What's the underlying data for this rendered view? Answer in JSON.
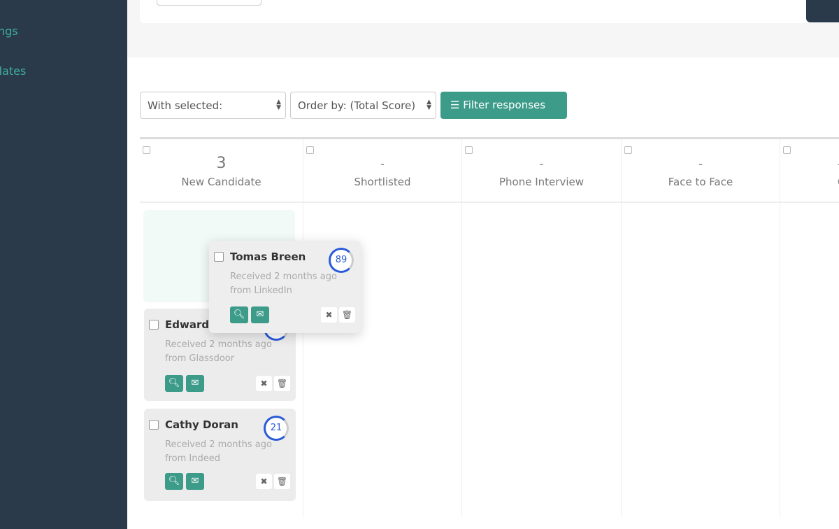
{
  "sidebar": {
    "items": [
      {
        "label": "Settings"
      },
      {
        "label": "Templates"
      }
    ]
  },
  "toolbar": {
    "with_selected": "With selected:",
    "order_by": "Order by: (Total Score)",
    "filter_label": "Filter responses"
  },
  "columns": [
    {
      "count": "3",
      "name": "New Candidate"
    },
    {
      "count": "-",
      "name": "Shortlisted"
    },
    {
      "count": "-",
      "name": "Phone Interview"
    },
    {
      "count": "-",
      "name": "Face to Face"
    },
    {
      "count": "-",
      "name": "Offer"
    }
  ],
  "cards": [
    {
      "name": "Tomas Breen",
      "received": "Received 2 months ago",
      "source": "from LinkedIn",
      "score": "89"
    },
    {
      "name": "Edward G",
      "received": "Received 2 months ago",
      "source": "from Glassdoor",
      "score": ""
    },
    {
      "name": "Cathy Doran",
      "received": "Received 2 months ago",
      "source": "from Indeed",
      "score": "21"
    }
  ],
  "colors": {
    "sidebar": "#2a3a4b",
    "accent": "#3d9b8a",
    "score": "#2a5bd7"
  }
}
